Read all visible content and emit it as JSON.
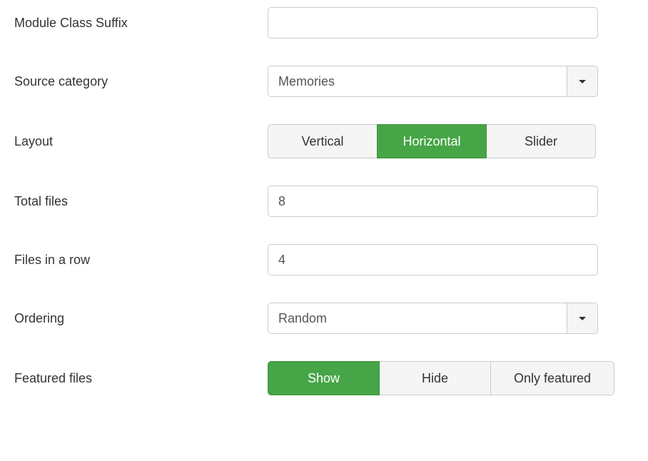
{
  "fields": {
    "moduleClassSuffix": {
      "label": "Module Class Suffix",
      "value": ""
    },
    "sourceCategory": {
      "label": "Source category",
      "value": "Memories"
    },
    "layout": {
      "label": "Layout",
      "options": [
        "Vertical",
        "Horizontal",
        "Slider"
      ],
      "selected": "Horizontal"
    },
    "totalFiles": {
      "label": "Total files",
      "value": "8"
    },
    "filesInRow": {
      "label": "Files in a row",
      "value": "4"
    },
    "ordering": {
      "label": "Ordering",
      "value": "Random"
    },
    "featuredFiles": {
      "label": "Featured files",
      "options": [
        "Show",
        "Hide",
        "Only featured"
      ],
      "selected": "Show"
    }
  },
  "colors": {
    "accent": "#46a546"
  }
}
